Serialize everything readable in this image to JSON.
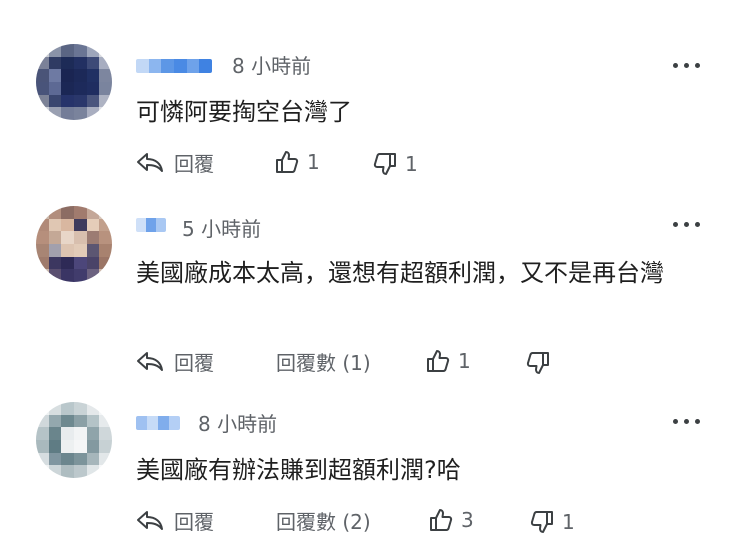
{
  "comments": [
    {
      "time": "8 小時前",
      "text": "可憐阿要掏空台灣了",
      "reply_label": "回覆",
      "likes": "1",
      "dislikes": "1"
    },
    {
      "time": "5 小時前",
      "text": "美國廠成本太高，還想有超額利潤，又不是再台灣",
      "reply_label": "回覆",
      "replies_label": "回覆數 (1)",
      "likes": "1",
      "dislikes": ""
    },
    {
      "time": "8 小時前",
      "text": "美國廠有辦法賺到超額利潤?哈",
      "reply_label": "回覆",
      "replies_label": "回覆數 (2)",
      "likes": "3",
      "dislikes": "1"
    }
  ],
  "icons": {
    "reply": "reply-arrow-icon",
    "like": "thumbs-up-icon",
    "dislike": "thumbs-down-icon",
    "more": "more-horizontal-icon"
  },
  "colors": {
    "text": "#1f1f1f",
    "meta": "#5f6368",
    "name_blur": "#8fb8ee"
  }
}
